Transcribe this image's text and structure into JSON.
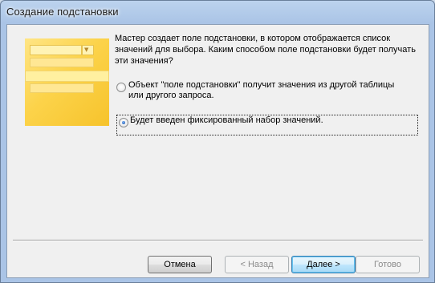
{
  "window": {
    "title": "Создание подстановки"
  },
  "wizard": {
    "description": "Мастер создает поле подстановки, в котором отображается список\nзначений для выбора.  Каким способом поле подстановки будет получать\n эти значения?",
    "options": [
      {
        "label": "Объект \"поле подстановки\" получит значения из другой таблицы\nили другого запроса.",
        "selected": false
      },
      {
        "label": "Будет введен фиксированный набор значений.",
        "selected": true
      }
    ]
  },
  "buttons": {
    "cancel": "Отмена",
    "back": "< Назад",
    "next": "Далее >",
    "finish": "Готово"
  },
  "colors": {
    "accent_illustration": "#fcd34a",
    "default_button": "#3c7fb1"
  }
}
